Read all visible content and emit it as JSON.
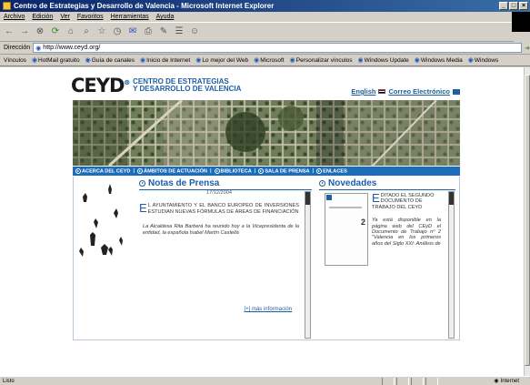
{
  "window": {
    "title": "Centro de Estrategias y Desarrollo de Valencia - Microsoft Internet Explorer"
  },
  "menu": [
    "Archivo",
    "Edición",
    "Ver",
    "Favoritos",
    "Herramientas",
    "Ayuda"
  ],
  "address": {
    "label": "Dirección",
    "url": "http://www.ceyd.org/"
  },
  "links_bar": {
    "label": "Vínculos",
    "items": [
      "HotMail gratuito",
      "Guía de canales",
      "Inicio de Internet",
      "Lo mejor del Web",
      "Microsoft",
      "Personalizar vínculos",
      "Windows Update",
      "Windows Media",
      "Windows"
    ]
  },
  "status": {
    "left": "Listo",
    "zone": "Internet"
  },
  "site": {
    "logo": "CEYD",
    "logo_line1": "CENTRO DE ESTRATEGIAS",
    "logo_line2": "Y DESARROLLO DE VALENCIA",
    "english": "English",
    "email": "Correo Electrónico",
    "nav": [
      "ACERCA DEL CEYD",
      "ÁMBITOS DE ACTUACIÓN",
      "BIBLIOTECA",
      "SALA DE PRENSA",
      "ENLACES"
    ]
  },
  "news": {
    "title": "Notas de Prensa",
    "date": "17/12/2004",
    "headline_initial": "E",
    "headline_rest": "L AYUNTAMIENTO Y EL BANCO EUROPEO DE INVERSIONES ESTUDIAN NUEVAS FÓRMULAS DE ÁREAS DE FINANCIACIÓN",
    "body": "La Alcaldesa Rita Barberá ha reunido hoy a la Vicepresidenta de la entidad, la española Isabel Martín Castellá",
    "more": "[+] más información"
  },
  "novedades": {
    "title": "Novedades",
    "headline_initial": "E",
    "headline_rest": "DITADO EL SEGUNDO DOCUMENTO DE TRABAJO DEL CEYD",
    "body": "Ya está disponible en la página web del CEyD el Documento de Trabajo nº 2 \"Valencia en los primeros años del Siglo XXI: Análisis de",
    "thumb_number": "2"
  }
}
